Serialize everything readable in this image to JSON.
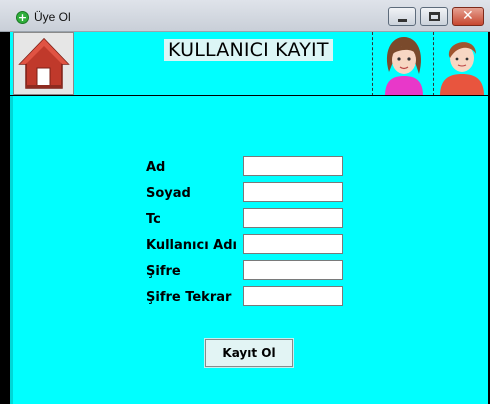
{
  "window": {
    "title": "Üye Ol",
    "icon": "plus-circle-icon",
    "controls": {
      "minimize_icon": "minimize-icon",
      "maximize_icon": "maximize-icon",
      "close_icon": "close-icon",
      "close_glyph": "✕"
    }
  },
  "header": {
    "title": "KULLANICI KAYIT",
    "home_icon": "home-icon",
    "avatars": [
      "female-user-avatar",
      "male-user-avatar"
    ]
  },
  "form": {
    "fields": [
      {
        "label": "Ad",
        "value": ""
      },
      {
        "label": "Soyad",
        "value": ""
      },
      {
        "label": "Tc",
        "value": ""
      },
      {
        "label": "Kullanıcı Adı",
        "value": ""
      },
      {
        "label": "Şifre",
        "value": ""
      },
      {
        "label": "Şifre Tekrar",
        "value": ""
      }
    ],
    "submit_label": "Kayıt Ol"
  },
  "colors": {
    "background": "#00ffff",
    "title_bg": "#dcf6f6",
    "home_roof": "#c0392b"
  }
}
